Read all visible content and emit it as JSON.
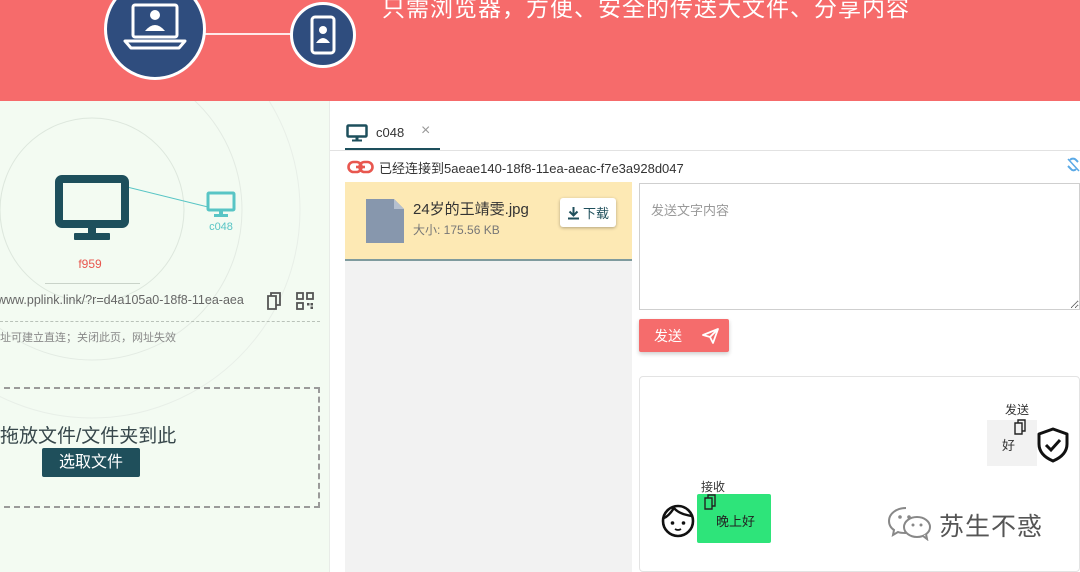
{
  "banner": {
    "tagline": "只需浏览器，方便、安全的传送大文件、分享内容"
  },
  "local_device": {
    "name": "f959"
  },
  "peer_device": {
    "name": "c048"
  },
  "share": {
    "url": "www.pplink.link/?r=d4a105a0-18f8-11ea-aea",
    "hint": "址可建立直连；关闭此页，网址失效"
  },
  "dropzone": {
    "label": "拖放文件/文件夹到此",
    "button": "选取文件"
  },
  "tab": {
    "label": "c048",
    "close": "×"
  },
  "connection": {
    "status": "已经连接到5aeae140-18f8-11ea-aeac-f7e3a928d047"
  },
  "files": [
    {
      "name": "24岁的王靖雯.jpg",
      "size": "大小: 175.56 KB",
      "action": "下载"
    }
  ],
  "composer": {
    "placeholder": "发送文字内容",
    "send_label": "发送"
  },
  "chat": {
    "messages": [
      {
        "label": "发送",
        "text": "好"
      },
      {
        "label": "接收",
        "text": "晚上好"
      }
    ]
  },
  "watermark": {
    "text": "苏生不惑"
  },
  "icons": [
    "laptop-icon",
    "phone-icon",
    "monitor-icon",
    "copy-icon",
    "qrcode-icon",
    "link-icon",
    "unlink-icon",
    "file-icon",
    "download-icon",
    "send-plane-icon",
    "face-icon",
    "shield-check-icon",
    "wechat-icon"
  ],
  "colors": {
    "banner": "#f66b6b",
    "send_button": "#f56c6c",
    "dark_teal": "#1f4f5b",
    "peer_teal": "#58c5c5",
    "local_device_label": "#e8574f",
    "file_item_bg": "#fde9b4",
    "received_bubble": "#2ee47a",
    "left_panel_bg": "#f3fbf2"
  }
}
